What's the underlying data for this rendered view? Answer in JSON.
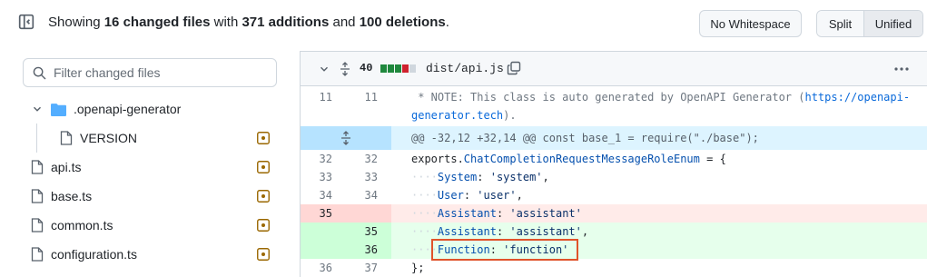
{
  "toolbar": {
    "summary_prefix": "Showing ",
    "files_changed": "16 changed files",
    "summary_with": " with ",
    "additions": "371 additions",
    "summary_and": " and ",
    "deletions": "100 deletions",
    "summary_end": ".",
    "no_whitespace_label": "No Whitespace",
    "split_label": "Split",
    "unified_label": "Unified"
  },
  "sidebar": {
    "filter_placeholder": "Filter changed files",
    "items": [
      {
        "label": ".openapi-generator",
        "type": "folder"
      },
      {
        "label": "VERSION",
        "type": "file"
      },
      {
        "label": "api.ts",
        "type": "file"
      },
      {
        "label": "base.ts",
        "type": "file"
      },
      {
        "label": "common.ts",
        "type": "file"
      },
      {
        "label": "configuration.ts",
        "type": "file"
      }
    ]
  },
  "file": {
    "change_count": "40",
    "filename": "dist/api.js",
    "hunk_header": "@@ -32,12 +32,14 @@ const base_1 = require(\"./base\");"
  },
  "diff_lines": [
    {
      "old": "11",
      "new": "11",
      "text_a": " * NOTE: This class is auto generated by OpenAPI Generator (",
      "link": "https://openapi-",
      "kind": "ctx"
    },
    {
      "old": "",
      "new": "",
      "text_a": "generator.tech",
      "text_b": ").",
      "kind": "ctx-wrap"
    },
    {
      "old": "32",
      "new": "32",
      "text_a": "exports.",
      "text_b": "ChatCompletionRequestMessageRoleEnum",
      "text_c": " = {",
      "kind": "ctx"
    },
    {
      "old": "33",
      "new": "33",
      "key": "System",
      "value": "'system'",
      "kind": "ctx"
    },
    {
      "old": "34",
      "new": "34",
      "key": "User",
      "value": "'user'",
      "kind": "ctx"
    },
    {
      "old": "35",
      "new": "",
      "key": "Assistant",
      "value": "'assistant'",
      "kind": "del"
    },
    {
      "old": "",
      "new": "35",
      "key": "Assistant",
      "value": "'assistant'",
      "kind": "add"
    },
    {
      "old": "",
      "new": "36",
      "key": "Function",
      "value": "'function'",
      "kind": "add"
    },
    {
      "old": "36",
      "new": "37",
      "text_a": "};",
      "kind": "ctx"
    }
  ],
  "colors": {
    "deletion": "#ffebe9",
    "addition": "#e6ffec",
    "hunk": "#ddf4ff",
    "highlight": "#e0532b"
  }
}
